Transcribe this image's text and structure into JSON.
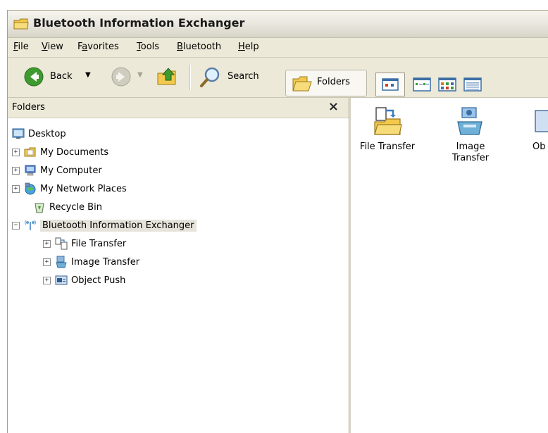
{
  "window": {
    "title": "Bluetooth Information Exchanger"
  },
  "menu": [
    {
      "pre": "",
      "ul": "F",
      "post": "ile"
    },
    {
      "pre": "",
      "ul": "V",
      "post": "iew"
    },
    {
      "pre": "F",
      "ul": "a",
      "post": "vorites"
    },
    {
      "pre": "",
      "ul": "T",
      "post": "ools"
    },
    {
      "pre": "",
      "ul": "B",
      "post": "luetooth"
    },
    {
      "pre": "",
      "ul": "H",
      "post": "elp"
    }
  ],
  "toolbar": {
    "back_label": "Back",
    "search_label": "Search",
    "folders_label": "Folders"
  },
  "folders_pane": {
    "title": "Folders",
    "close_glyph": "×",
    "tree": [
      {
        "label": "Desktop",
        "icon": "desktop-icon",
        "expander": ""
      },
      {
        "label": "My Documents",
        "icon": "my-documents-icon",
        "expander": "+"
      },
      {
        "label": "My Computer",
        "icon": "my-computer-icon",
        "expander": "+"
      },
      {
        "label": "My Network Places",
        "icon": "network-places-icon",
        "expander": "+"
      },
      {
        "label": "Recycle Bin",
        "icon": "recycle-bin-icon",
        "expander": ""
      },
      {
        "label": "Bluetooth Information Exchanger",
        "icon": "bluetooth-icon",
        "expander": "−"
      },
      {
        "label": "File Transfer",
        "icon": "file-transfer-icon",
        "expander": "+"
      },
      {
        "label": "Image Transfer",
        "icon": "image-transfer-icon",
        "expander": "+"
      },
      {
        "label": "Object Push",
        "icon": "object-push-icon",
        "expander": "+"
      }
    ]
  },
  "content": {
    "items": [
      {
        "label": "File Transfer",
        "icon": "file-transfer-icon"
      },
      {
        "label": "Image Transfer",
        "icon": "image-transfer-icon"
      },
      {
        "label": "Ob",
        "icon": "object-push-icon"
      }
    ]
  },
  "colors": {
    "chrome": "#ece9d8",
    "selection": "#e5e3da",
    "back_green": "#3f9a2f"
  }
}
